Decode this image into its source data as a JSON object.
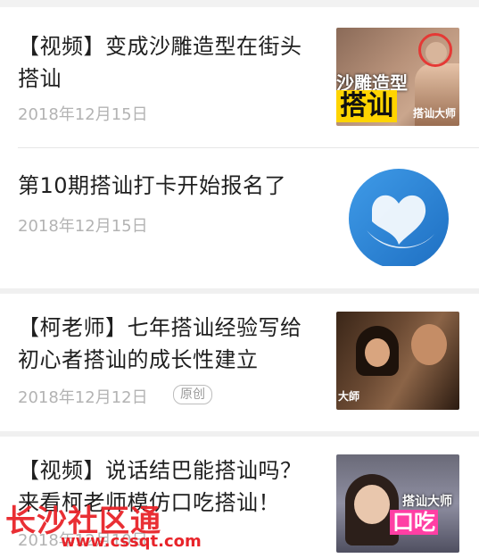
{
  "articles": [
    {
      "title": "【视频】变成沙雕造型在街头搭讪",
      "date": "2018年12月15日",
      "thumb_caption_top": "沙雕造型",
      "thumb_caption_main": "搭讪",
      "thumb_logo": "搭讪大师"
    },
    {
      "title": "第10期搭讪打卡开始报名了",
      "date": "2018年12月15日"
    },
    {
      "title": "【柯老师】七年搭讪经验写给初心者搭讪的成长性建立",
      "date": "2018年12月12日",
      "badge": "原创",
      "thumb_logo": "大師"
    },
    {
      "title": "【视频】说话结巴能搭讪吗？来看柯老师模仿口吃搭讪！",
      "date": "2018年12月10日",
      "thumb_logo": "搭讪大师",
      "thumb_caption_main": "口吃"
    }
  ],
  "watermark": {
    "name": "长沙社区通",
    "url": "www.cssqt.com"
  },
  "colors": {
    "title": "#1f1f1f",
    "date": "#b3b3b3",
    "watermark": "#e8242a",
    "logo_blue": "#2a7fd4"
  }
}
